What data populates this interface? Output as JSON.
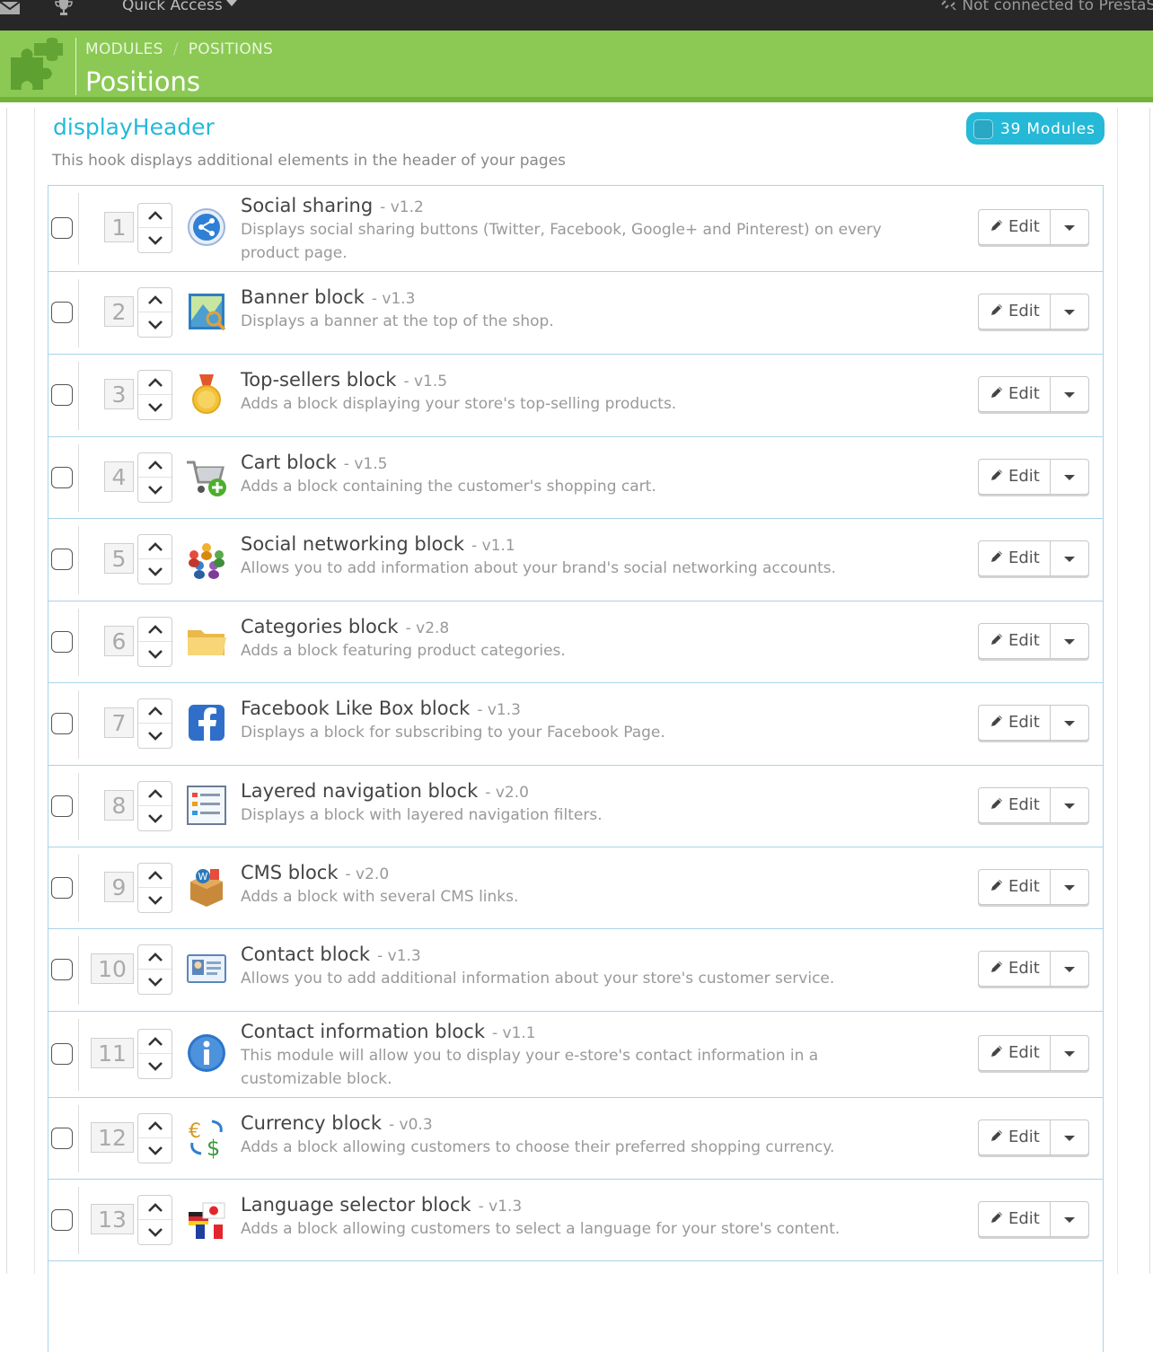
{
  "topbar": {
    "quick_access": "Quick Access",
    "connection_status": "Not connected to PrestaS"
  },
  "header": {
    "breadcrumb": [
      "MODULES",
      "POSITIONS"
    ],
    "title": "Positions"
  },
  "hook": {
    "name": "displayHeader",
    "description": "This hook displays additional elements in the header of your pages",
    "module_count": "39 Modules"
  },
  "edit_label": "Edit",
  "modules": [
    {
      "position": "1",
      "name": "Social sharing",
      "version": "- v1.2",
      "description": "Displays social sharing buttons (Twitter, Facebook, Google+ and Pinterest) on every product page.",
      "icon": "share-icon"
    },
    {
      "position": "2",
      "name": "Banner block",
      "version": "- v1.3",
      "description": "Displays a banner at the top of the shop.",
      "icon": "banner-icon"
    },
    {
      "position": "3",
      "name": "Top-sellers block",
      "version": "- v1.5",
      "description": "Adds a block displaying your store's top-selling products.",
      "icon": "medal-icon"
    },
    {
      "position": "4",
      "name": "Cart block",
      "version": "- v1.5",
      "description": "Adds a block containing the customer's shopping cart.",
      "icon": "cart-icon"
    },
    {
      "position": "5",
      "name": "Social networking block",
      "version": "- v1.1",
      "description": "Allows you to add information about your brand's social networking accounts.",
      "icon": "people-icon"
    },
    {
      "position": "6",
      "name": "Categories block",
      "version": "- v2.8",
      "description": "Adds a block featuring product categories.",
      "icon": "folder-icon"
    },
    {
      "position": "7",
      "name": "Facebook Like Box block",
      "version": "- v1.3",
      "description": "Displays a block for subscribing to your Facebook Page.",
      "icon": "facebook-icon"
    },
    {
      "position": "8",
      "name": "Layered navigation block",
      "version": "- v2.0",
      "description": "Displays a block with layered navigation filters.",
      "icon": "filter-list-icon"
    },
    {
      "position": "9",
      "name": "CMS block",
      "version": "- v2.0",
      "description": "Adds a block with several CMS links.",
      "icon": "box-icon"
    },
    {
      "position": "10",
      "name": "Contact block",
      "version": "- v1.3",
      "description": "Allows you to add additional information about your store's customer service.",
      "icon": "contact-card-icon"
    },
    {
      "position": "11",
      "name": "Contact information block",
      "version": "- v1.1",
      "description": "This module will allow you to display your e-store's contact information in a customizable block.",
      "icon": "info-icon"
    },
    {
      "position": "12",
      "name": "Currency block",
      "version": "- v0.3",
      "description": "Adds a block allowing customers to choose their preferred shopping currency.",
      "icon": "currency-icon"
    },
    {
      "position": "13",
      "name": "Language selector block",
      "version": "- v1.3",
      "description": "Adds a block allowing customers to select a language for your store's content.",
      "icon": "flags-icon"
    }
  ]
}
